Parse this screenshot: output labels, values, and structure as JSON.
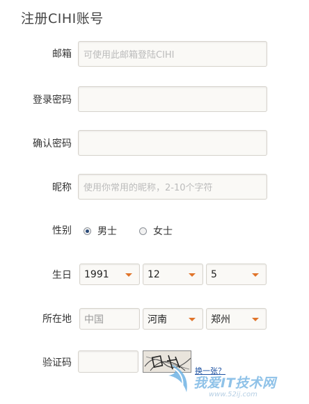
{
  "title": "注册CIHI账号",
  "form": {
    "email": {
      "label": "邮箱",
      "placeholder": "可使用此邮箱登陆CIHI"
    },
    "password": {
      "label": "登录密码",
      "placeholder": ""
    },
    "confirm": {
      "label": "确认密码",
      "placeholder": ""
    },
    "nickname": {
      "label": "昵称",
      "placeholder": "使用你常用的昵称，2-10个字符"
    },
    "gender": {
      "label": "性别",
      "options": [
        {
          "label": "男士",
          "selected": true
        },
        {
          "label": "女士",
          "selected": false
        }
      ]
    },
    "birthday": {
      "label": "生日",
      "year": "1991",
      "month": "12",
      "day": "5"
    },
    "location": {
      "label": "所在地",
      "country": "中国",
      "province": "河南",
      "city": "郑州"
    },
    "captcha": {
      "label": "验证码",
      "value": "",
      "refresh_link": "换一张？"
    }
  },
  "watermark": {
    "text": "我爱IT技术网",
    "url": "www.52ij.com"
  },
  "colors": {
    "arrow": "#e0742a",
    "link": "#1a4fa0",
    "watermark": "#8fc2e8"
  }
}
